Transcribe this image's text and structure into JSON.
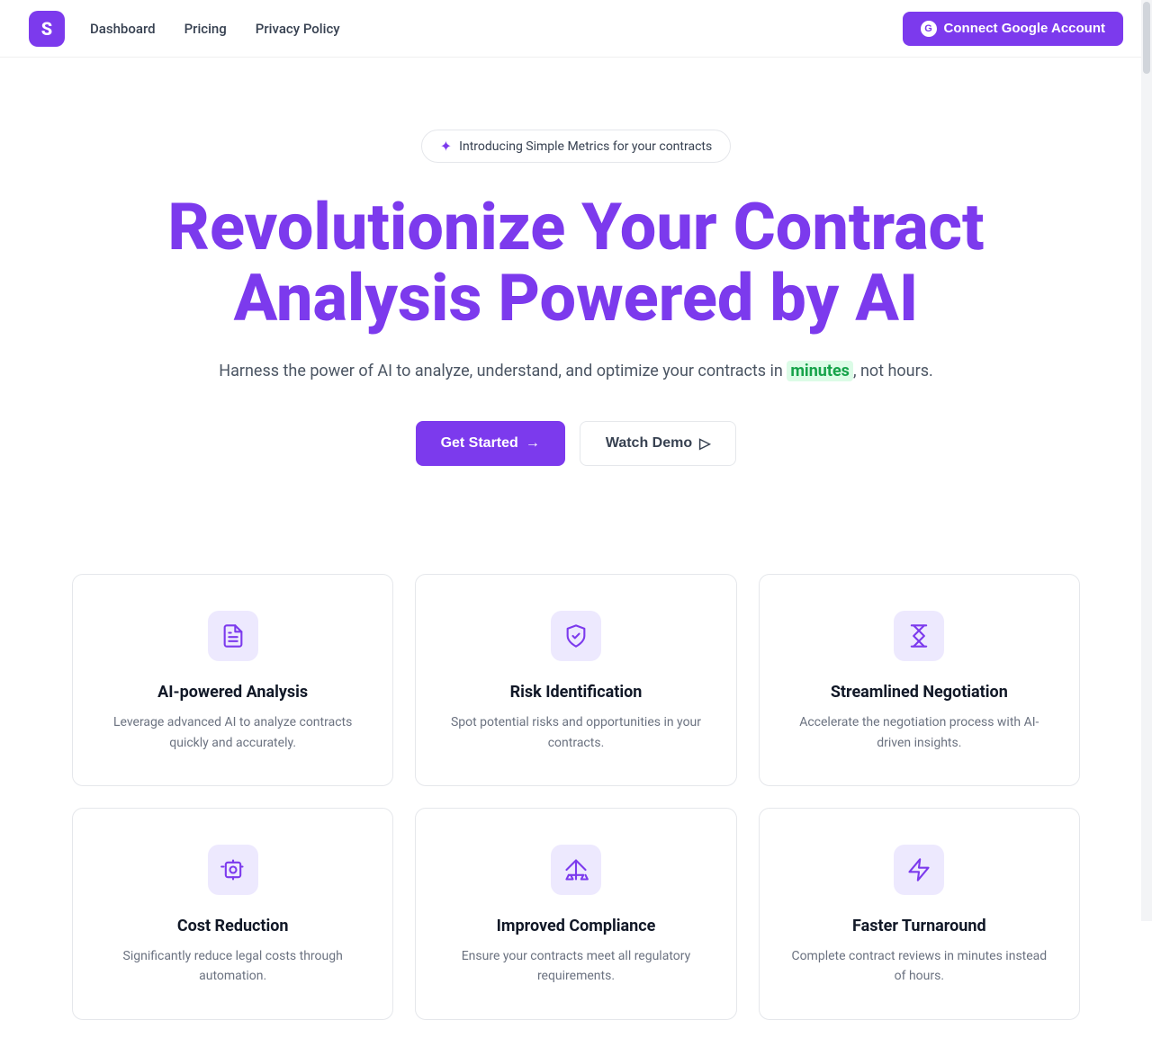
{
  "nav": {
    "logo_letter": "S",
    "links": [
      {
        "label": "Dashboard",
        "href": "#"
      },
      {
        "label": "Pricing",
        "href": "#"
      },
      {
        "label": "Privacy Policy",
        "href": "#"
      }
    ],
    "connect_button": "Connect Google Account",
    "g_letter": "G"
  },
  "hero": {
    "badge_icon": "✦",
    "badge_text": "Introducing Simple Metrics for your contracts",
    "title": "Revolutionize Your Contract Analysis Powered by AI",
    "subtitle_before": "Harness the power of AI to analyze, understand, and optimize your contracts in ",
    "subtitle_highlight": "minutes",
    "subtitle_after": ", not hours.",
    "btn_primary": "Get Started",
    "btn_primary_arrow": "→",
    "btn_secondary": "Watch Demo",
    "btn_secondary_icon": "▷"
  },
  "features": [
    {
      "title": "AI-powered Analysis",
      "desc": "Leverage advanced AI to analyze contracts quickly and accurately.",
      "icon_type": "document"
    },
    {
      "title": "Risk Identification",
      "desc": "Spot potential risks and opportunities in your contracts.",
      "icon_type": "shield"
    },
    {
      "title": "Streamlined Negotiation",
      "desc": "Accelerate the negotiation process with AI-driven insights.",
      "icon_type": "hourglass"
    },
    {
      "title": "Cost Reduction",
      "desc": "Significantly reduce legal costs through automation.",
      "icon_type": "piggy"
    },
    {
      "title": "Improved Compliance",
      "desc": "Ensure your contracts meet all regulatory requirements.",
      "icon_type": "scale"
    },
    {
      "title": "Faster Turnaround",
      "desc": "Complete contract reviews in minutes instead of hours.",
      "icon_type": "lightning"
    }
  ]
}
